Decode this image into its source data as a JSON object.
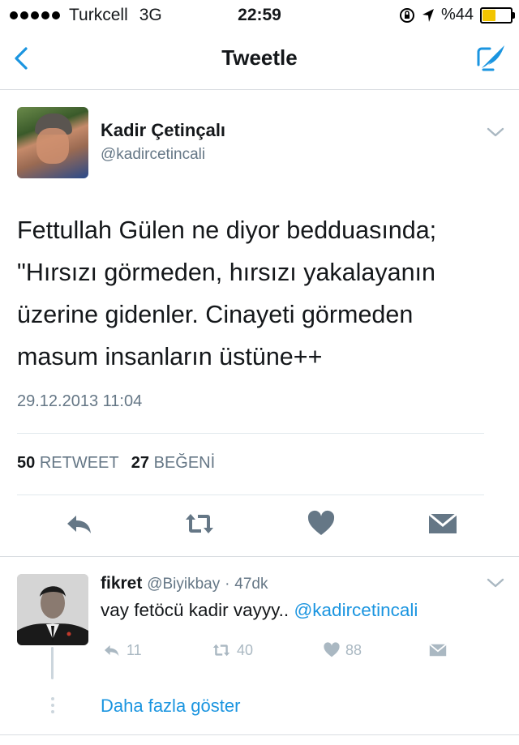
{
  "status_bar": {
    "carrier": "Turkcell",
    "network": "3G",
    "time": "22:59",
    "battery_text": "%44",
    "battery_level": 0.44
  },
  "nav": {
    "title": "Tweetle",
    "back_icon": "chevron-left-icon",
    "compose_icon": "compose-tweet-icon",
    "accent_color": "#1b95e0"
  },
  "tweet": {
    "author_name": "Kadir Çetinçalı",
    "author_handle": "@kadircetincali",
    "text_lines": [
      "Fettullah Gülen ne diyor bedduasında;",
      "\"Hırsızı görmeden, hırsızı yakalayanın",
      "üzerine gidenler. Cinayeti görmeden",
      "masum insanların üstüne++"
    ],
    "date": "29.12.2013 11:04",
    "retweet_count": "50",
    "retweet_label": "RETWEET",
    "like_count": "27",
    "like_label": "BEĞENİ"
  },
  "reply": {
    "name": "fikret",
    "handle": "@Biyikbay",
    "separator": "·",
    "age": "47dk",
    "text": "vay fetöcü kadir vayyy..",
    "mention": "@kadircetincali",
    "reply_count": "11",
    "retweet_count": "40",
    "like_count": "88"
  },
  "show_more": "Daha fazla göster"
}
